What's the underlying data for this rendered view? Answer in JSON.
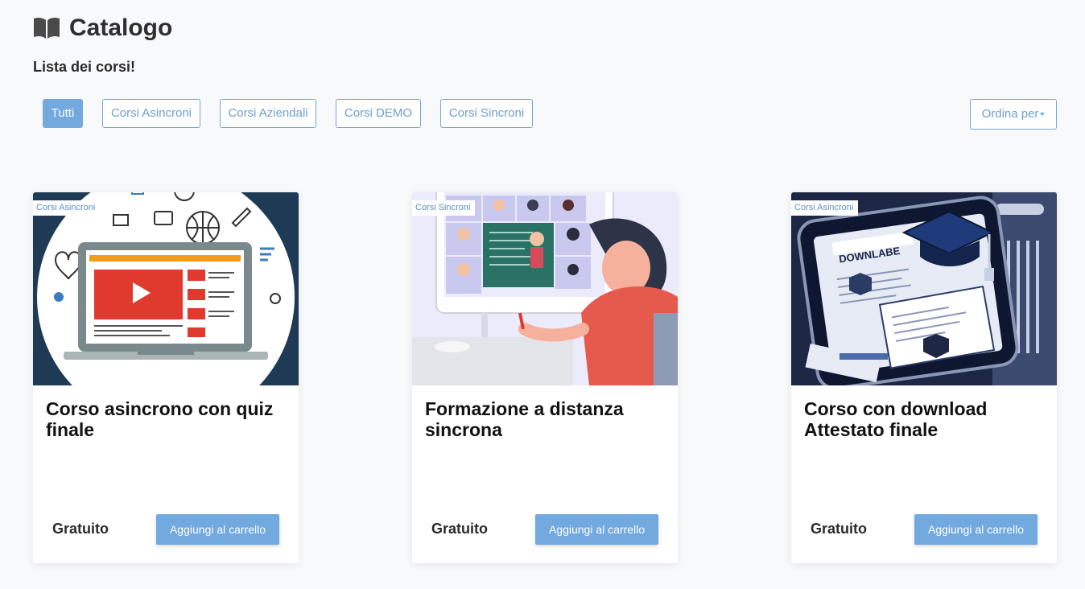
{
  "page": {
    "title": "Catalogo",
    "subtitle": "Lista dei corsi!",
    "icon": "book-icon"
  },
  "filters": [
    {
      "label": "Tutti",
      "active": true
    },
    {
      "label": "Corsi Asincroni",
      "active": false
    },
    {
      "label": "Corsi Aziendali",
      "active": false
    },
    {
      "label": "Corsi DEMO",
      "active": false
    },
    {
      "label": "Corsi Sincroni",
      "active": false
    }
  ],
  "sort": {
    "label": "Ordina per"
  },
  "colors": {
    "accent": "#72a9df",
    "background": "#f8f9fb"
  },
  "courses": [
    {
      "badge": "Corsi Asincroni",
      "title": "Corso asincrono con quiz finale",
      "price": "Gratuito",
      "cart_label": "Aggiungi al carrello",
      "image": "laptop-video-illustration"
    },
    {
      "badge": "Corsi Sincroni",
      "title": "Formazione a distanza sincrona",
      "price": "Gratuito",
      "cart_label": "Aggiungi al carrello",
      "image": "video-call-illustration"
    },
    {
      "badge": "Corsi Asincroni",
      "title": "Corso con download Attestato finale",
      "price": "Gratuito",
      "cart_label": "Aggiungi al carrello",
      "image": "tablet-certificate-illustration"
    }
  ]
}
